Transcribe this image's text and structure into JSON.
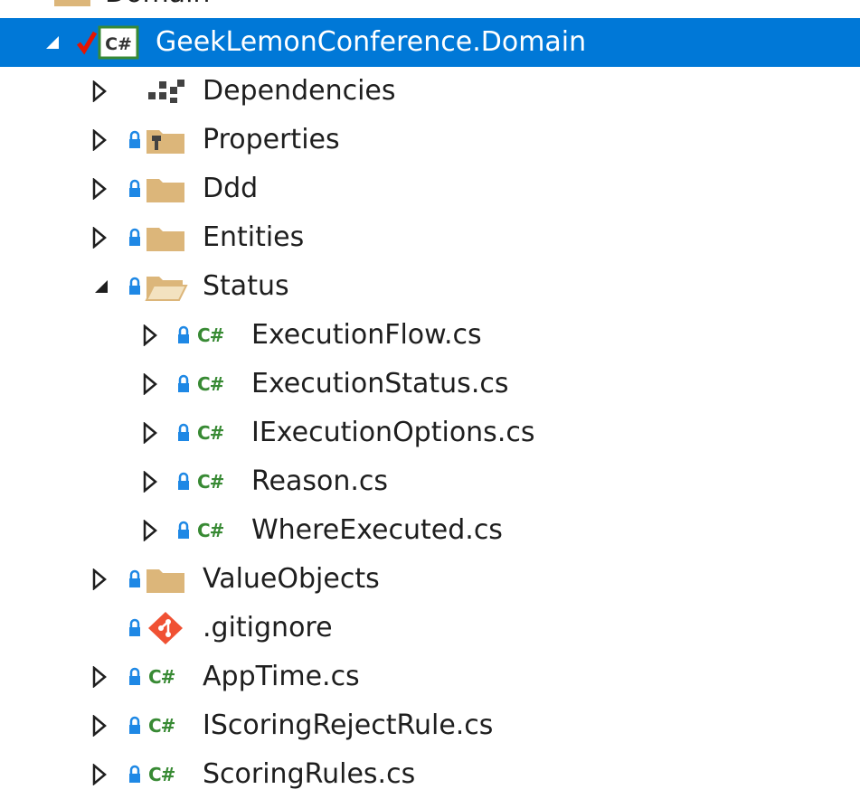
{
  "solution_explorer": {
    "parent_item": {
      "label": "Domain"
    },
    "project": {
      "label": "GeekLemonConference.Domain",
      "icon": "csharp-project-icon"
    },
    "items": [
      {
        "label": "Dependencies",
        "icon": "dependencies-icon"
      },
      {
        "label": "Properties",
        "icon": "properties-folder-icon"
      },
      {
        "label": "Ddd",
        "icon": "folder-icon"
      },
      {
        "label": "Entities",
        "icon": "folder-icon"
      },
      {
        "label": "Status",
        "icon": "open-folder-icon"
      },
      {
        "label": "ExecutionFlow.cs",
        "icon": "csharp-file-icon"
      },
      {
        "label": "ExecutionStatus.cs",
        "icon": "csharp-file-icon"
      },
      {
        "label": "IExecutionOptions.cs",
        "icon": "csharp-file-icon"
      },
      {
        "label": "Reason.cs",
        "icon": "csharp-file-icon"
      },
      {
        "label": "WhereExecuted.cs",
        "icon": "csharp-file-icon"
      },
      {
        "label": "ValueObjects",
        "icon": "folder-icon"
      },
      {
        "label": ".gitignore",
        "icon": "git-icon"
      },
      {
        "label": "AppTime.cs",
        "icon": "csharp-file-icon"
      },
      {
        "label": "IScoringRejectRule.cs",
        "icon": "csharp-file-icon"
      },
      {
        "label": "ScoringRules.cs",
        "icon": "csharp-file-icon"
      }
    ],
    "csharp_glyph": "C#",
    "colors": {
      "selection": "#0078d7",
      "folder": "#dcb67a",
      "csharp": "#388a34",
      "lock": "#1e88e5",
      "git": "#f05133",
      "checkmark": "#e51400"
    }
  }
}
